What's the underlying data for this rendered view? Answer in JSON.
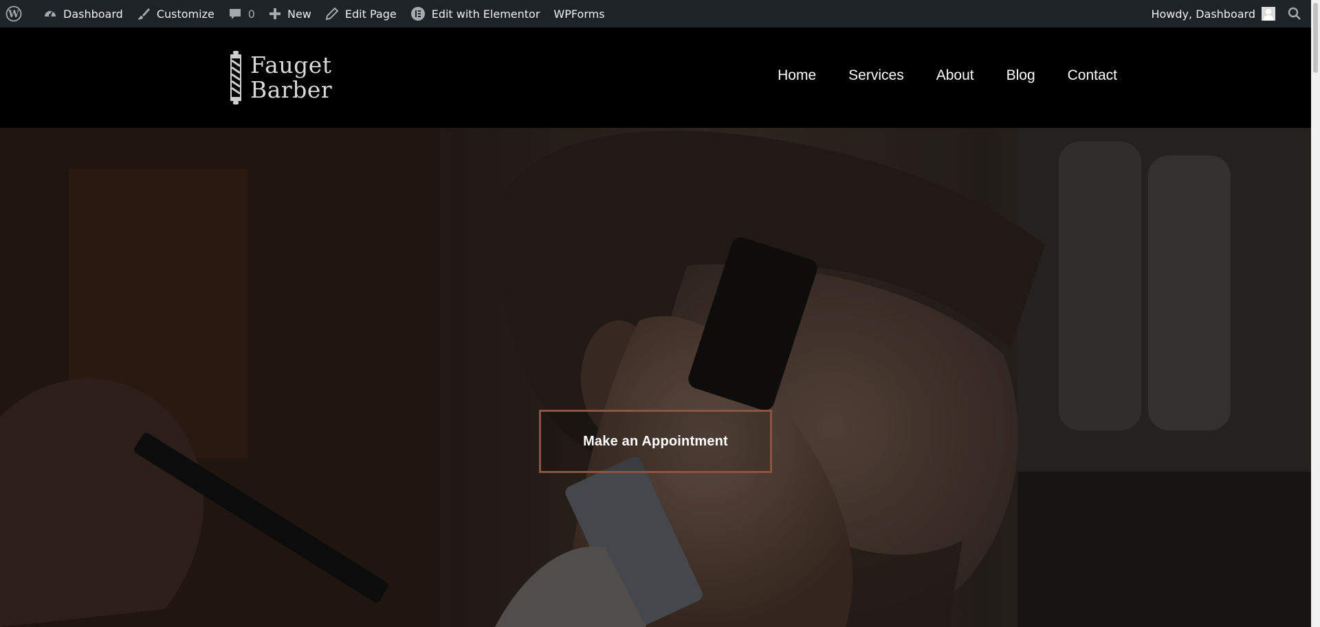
{
  "admin_bar": {
    "dashboard": "Dashboard",
    "customize": "Customize",
    "comments_count": "0",
    "new": "New",
    "edit_page": "Edit Page",
    "edit_elementor": "Edit with Elementor",
    "wpforms": "WPForms",
    "greeting": "Howdy, Dashboard"
  },
  "site": {
    "logo_line1": "Fauget",
    "logo_line2": "Barber",
    "nav": [
      "Home",
      "Services",
      "About",
      "Blog",
      "Contact"
    ]
  },
  "hero": {
    "cta_label": "Make an Appointment"
  },
  "colors": {
    "admin_bar_bg": "#1d2327",
    "header_bg": "#000000",
    "cta_border": "#8a5641"
  },
  "icons": [
    "wordpress-icon",
    "dashboard-gauge-icon",
    "brush-icon",
    "comment-icon",
    "plus-icon",
    "pencil-icon",
    "elementor-icon",
    "search-icon",
    "barber-pole-icon"
  ]
}
